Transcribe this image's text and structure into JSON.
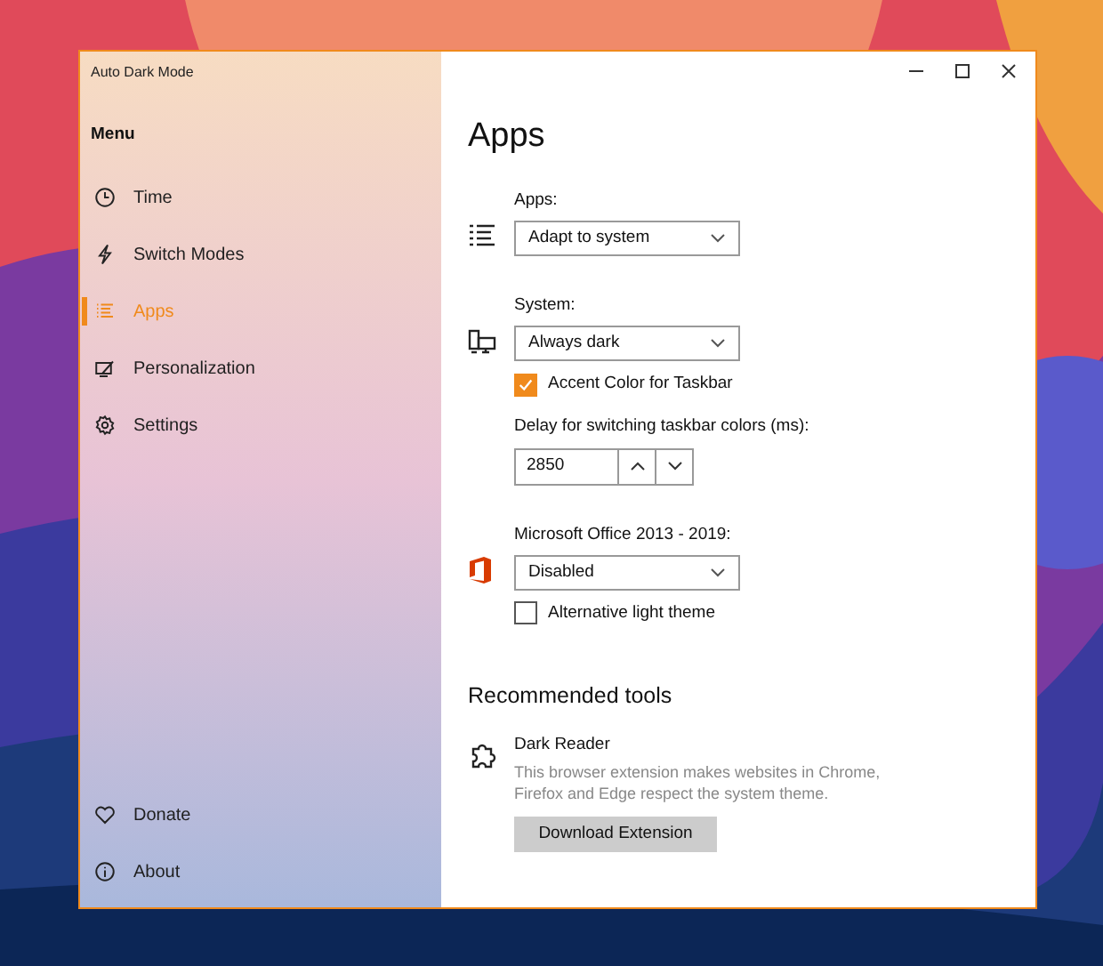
{
  "window": {
    "title": "Auto Dark Mode"
  },
  "sidebar": {
    "heading": "Menu",
    "items": [
      {
        "label": "Time",
        "selected": false
      },
      {
        "label": "Switch Modes",
        "selected": false
      },
      {
        "label": "Apps",
        "selected": true
      },
      {
        "label": "Personalization",
        "selected": false
      },
      {
        "label": "Settings",
        "selected": false
      }
    ],
    "footer_items": [
      {
        "label": "Donate",
        "selected": false
      },
      {
        "label": "About",
        "selected": false
      }
    ]
  },
  "page": {
    "title": "Apps",
    "apps": {
      "label": "Apps:",
      "value": "Adapt to system"
    },
    "system": {
      "label": "System:",
      "value": "Always dark",
      "accent_checkbox": {
        "label": "Accent Color for Taskbar",
        "checked": true
      },
      "delay": {
        "label": "Delay for switching taskbar colors (ms):",
        "value": "2850"
      }
    },
    "office": {
      "label": "Microsoft Office 2013 - 2019:",
      "value": "Disabled",
      "light_checkbox": {
        "label": "Alternative light theme",
        "checked": false
      }
    },
    "recommended": {
      "heading": "Recommended tools",
      "tool": {
        "name": "Dark Reader",
        "description": "This browser extension makes websites in Chrome, Firefox and Edge respect the system theme.",
        "button": "Download Extension"
      }
    }
  }
}
